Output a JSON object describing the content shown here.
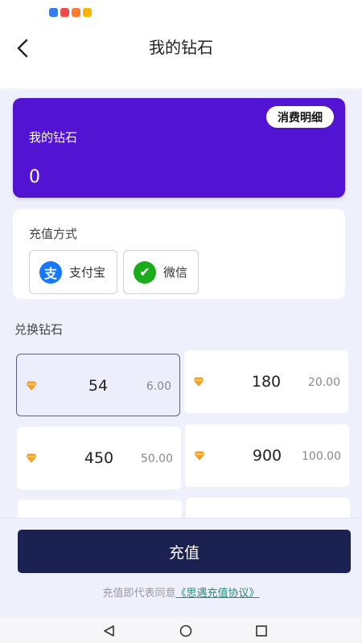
{
  "header": {
    "title": "我的钻石",
    "back_icon": "chevron-left-icon"
  },
  "status_bar": {
    "app_icon_colors": [
      "#2f7cf6",
      "#f04a4a",
      "#ff7a2f",
      "#f7b500"
    ]
  },
  "diamond_card": {
    "label": "我的钻石",
    "value": "0",
    "detail_button": "消费明细",
    "background_color": "#5313d3"
  },
  "payment": {
    "title": "充值方式",
    "methods": [
      {
        "label": "支付宝",
        "icon": "alipay-icon",
        "icon_text": "支",
        "color": "#1677ff"
      },
      {
        "label": "微信",
        "icon": "wechat-icon",
        "icon_text": "✔",
        "color": "#1aad19"
      }
    ]
  },
  "exchange": {
    "title": "兑换钻石",
    "packages": [
      {
        "amount": "54",
        "price": "6.00",
        "selected": true
      },
      {
        "amount": "180",
        "price": "20.00",
        "selected": false
      },
      {
        "amount": "450",
        "price": "50.00",
        "selected": false
      },
      {
        "amount": "900",
        "price": "100.00",
        "selected": false
      }
    ]
  },
  "recharge": {
    "button": "充值",
    "agreement_prefix": "充值即代表同意",
    "agreement_link": "《思遇充值协议》",
    "button_color": "#1b2150"
  },
  "system_nav": {
    "back": "triangle-back-icon",
    "home": "circle-home-icon",
    "recent": "square-recent-icon"
  }
}
